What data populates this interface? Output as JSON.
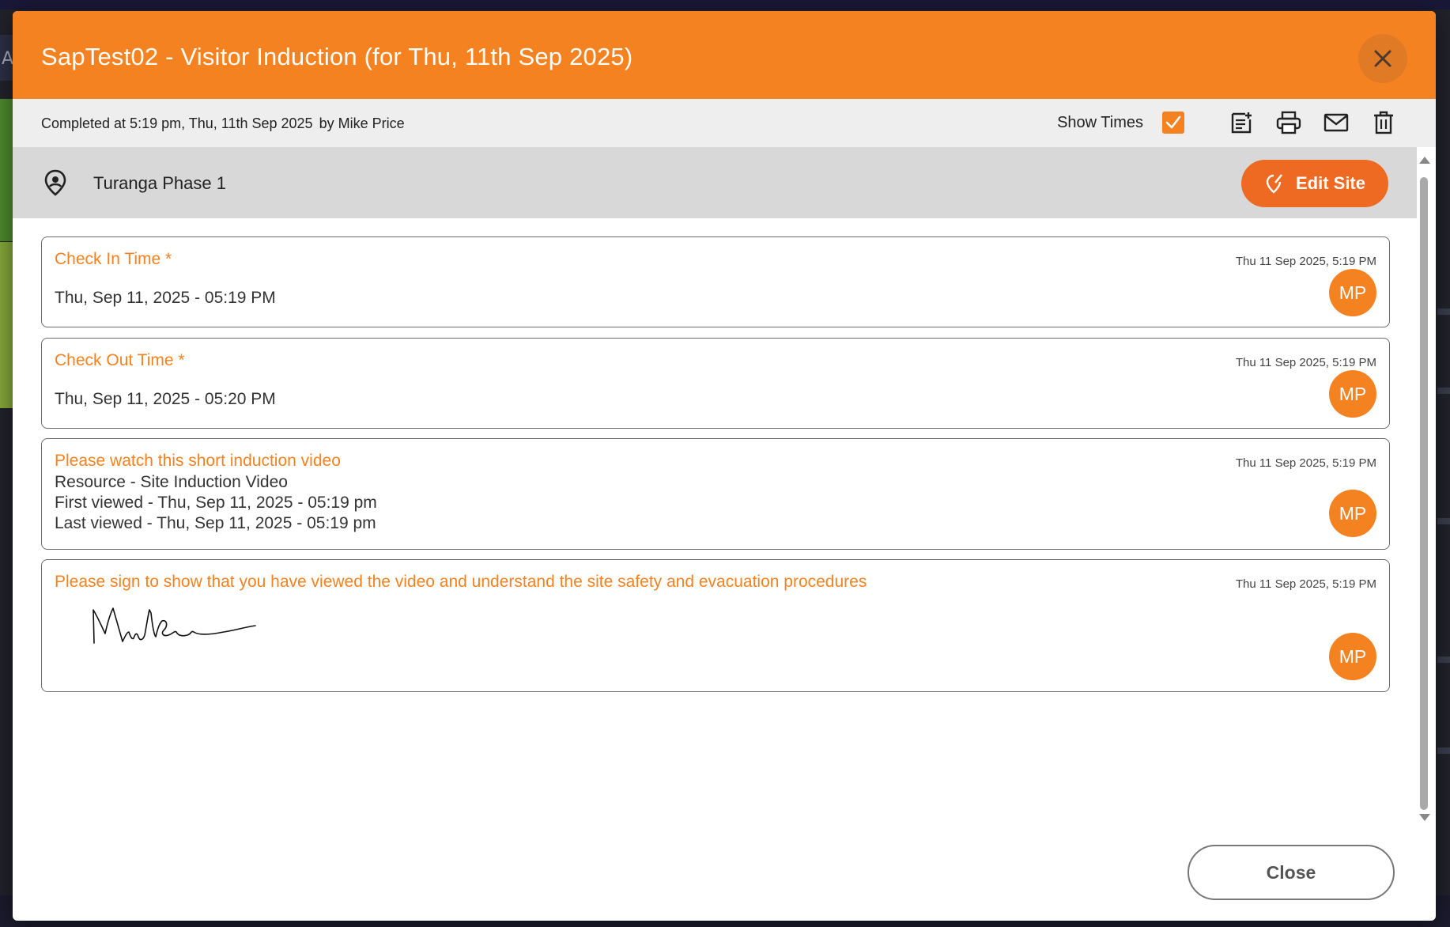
{
  "background": {
    "tab_letter": "A"
  },
  "header": {
    "title": "SapTest02 - Visitor Induction (for Thu, 11th Sep 2025)",
    "close_icon": "close-icon",
    "color": "#f58220"
  },
  "infobar": {
    "completed_text": "Completed at 5:19 pm, Thu, 11th Sep 2025",
    "by_text": "by Mike Price",
    "show_times_label": "Show Times",
    "show_times_checked": true,
    "icons": [
      "add-note-icon",
      "print-icon",
      "email-icon",
      "delete-icon"
    ]
  },
  "site": {
    "icon": "location-pin-icon",
    "name": "Turanga Phase 1",
    "edit_button_label": "Edit Site",
    "edit_button_color": "#ee6a22"
  },
  "cards": [
    {
      "label": "Check In Time *",
      "timestamp": "Thu 11 Sep 2025, 5:19 PM",
      "value": "Thu, Sep 11, 2025 - 05:19 PM",
      "avatar": "MP"
    },
    {
      "label": "Check Out Time *",
      "timestamp": "Thu 11 Sep 2025, 5:19 PM",
      "value": "Thu, Sep 11, 2025 - 05:20 PM",
      "avatar": "MP"
    },
    {
      "label": "Please watch this short induction video",
      "timestamp": "Thu 11 Sep 2025, 5:19 PM",
      "lines": [
        "Resource - Site Induction Video",
        "First viewed - Thu, Sep 11, 2025 - 05:19 pm",
        "Last viewed - Thu, Sep 11, 2025 - 05:19 pm"
      ],
      "avatar": "MP"
    },
    {
      "label": "Please sign to show that you have viewed the video and understand the site safety and evacuation procedures",
      "timestamp": "Thu 11 Sep 2025, 5:19 PM",
      "signature": "handwritten-signature",
      "avatar": "MP"
    }
  ],
  "footer": {
    "close_label": "Close"
  }
}
